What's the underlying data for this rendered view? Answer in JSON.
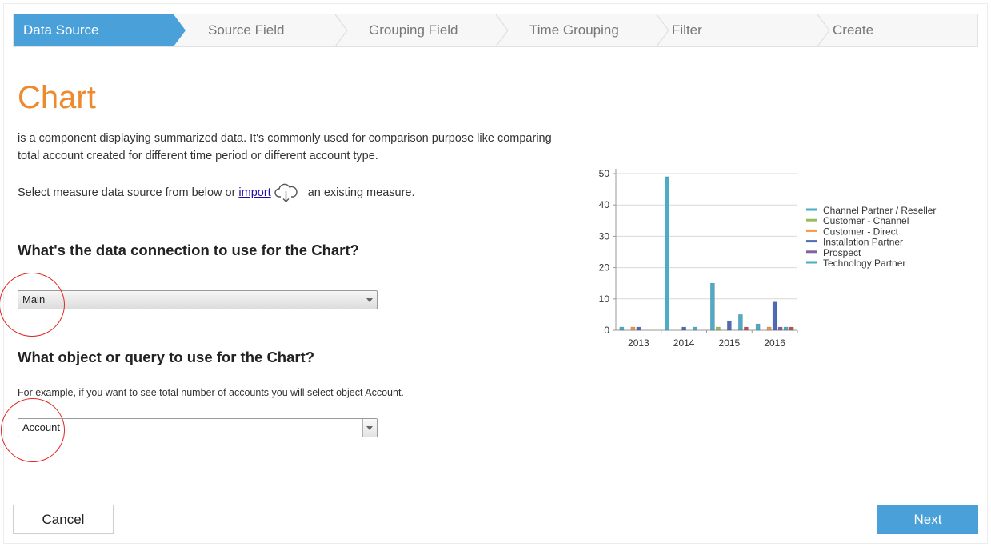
{
  "wizard": {
    "steps": [
      "Data Source",
      "Source Field",
      "Grouping Field",
      "Time Grouping",
      "Filter",
      "Create"
    ],
    "active_index": 0,
    "active_color": "#4aa0d8"
  },
  "page": {
    "title": "Chart",
    "title_color": "#ee8a2e",
    "description": "is a component displaying summarized data. It's commonly used for comparison purpose like comparing total account created for different time period or different account type.",
    "select_prefix": "Select measure data source from below or",
    "import_link": "import",
    "select_suffix": "an existing measure."
  },
  "connection": {
    "question": "What's the data connection to use for the Chart?",
    "selected": "Main"
  },
  "object": {
    "question": "What object or query to use for the Chart?",
    "hint": "For example, if you want to see total number of accounts you will select object Account.",
    "selected": "Account"
  },
  "buttons": {
    "cancel": "Cancel",
    "next": "Next"
  },
  "chart_data": {
    "type": "bar",
    "categories": [
      "2013",
      "2014",
      "2015",
      "2016"
    ],
    "ylim": [
      0,
      50
    ],
    "yticks": [
      0,
      10,
      20,
      30,
      40,
      50
    ],
    "legend_position": "right",
    "series": [
      {
        "name": "Channel Partner / Reseller",
        "color": "#4bacc6",
        "values": [
          1,
          49,
          15,
          2
        ]
      },
      {
        "name": "Customer - Channel",
        "color": "#9bbb59",
        "values": [
          0,
          0,
          1,
          0
        ]
      },
      {
        "name": "Customer - Direct",
        "color": "#f79646",
        "values": [
          1,
          0,
          0,
          1
        ]
      },
      {
        "name": "Installation Partner",
        "color": "#4f6bb5",
        "values": [
          1,
          1,
          3,
          9
        ]
      },
      {
        "name": "Prospect",
        "color": "#8064a2",
        "values": [
          0,
          0,
          0,
          1
        ]
      },
      {
        "name": "Technology Partner",
        "color": "#4bacc6",
        "values": [
          0,
          1,
          5,
          1
        ]
      },
      {
        "name": "Technology Partner",
        "color": "#c0504d",
        "values": [
          0,
          0,
          1,
          1
        ]
      }
    ]
  }
}
